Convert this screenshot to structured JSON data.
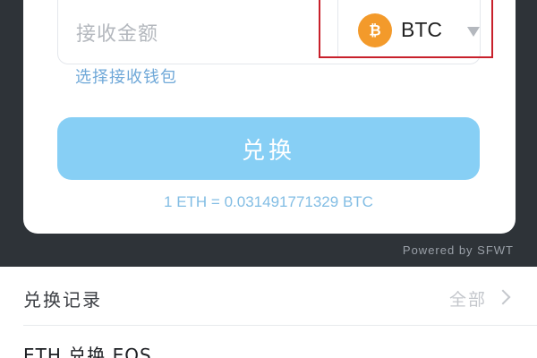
{
  "exchange_form": {
    "amount_placeholder": "接收金额",
    "selected_coin": "BTC",
    "coin_icon": "bitcoin-icon",
    "wallet_link": "选择接收钱包",
    "submit_label": "兑换",
    "rate": "1 ETH = 0.031491771329 BTC",
    "powered_by": "Powered by SFWT"
  },
  "history": {
    "title": "兑换记录",
    "all_label": "全部",
    "items": [
      "ETH 兑换 EOS"
    ]
  },
  "colors": {
    "accent": "#87cff5",
    "bitcoin": "#f39a2b",
    "highlight": "#c8202b",
    "dark_background": "#2e3338"
  }
}
